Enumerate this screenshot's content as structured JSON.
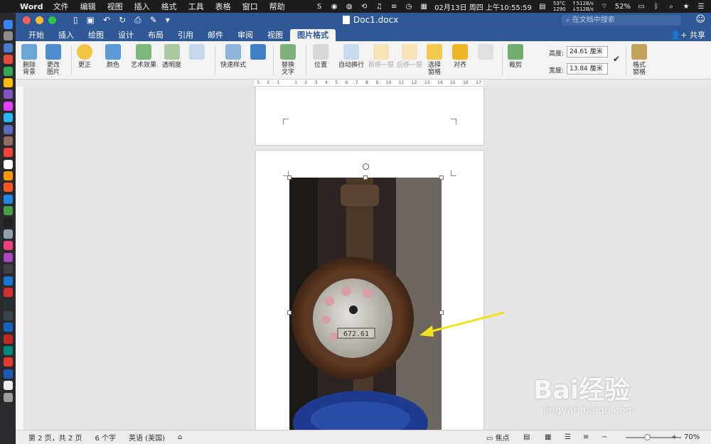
{
  "menubar": {
    "app_name": "Word",
    "menus": [
      "文件",
      "编辑",
      "视图",
      "插入",
      "格式",
      "工具",
      "表格",
      "窗口",
      "帮助"
    ],
    "datetime": "02月13日 周四 上午10:55:59",
    "battery": "52%",
    "temp_top": "53°C",
    "temp_bottom": "1290",
    "net_up": "↑512B/s",
    "net_down": "↓512B/s"
  },
  "titlebar": {
    "doc_title": "Doc1.docx",
    "search_placeholder": "在文档中搜索"
  },
  "tabs": [
    "开始",
    "插入",
    "绘图",
    "设计",
    "布局",
    "引用",
    "邮件",
    "审阅",
    "视图",
    "图片格式"
  ],
  "active_tab": "图片格式",
  "share_label": "共享",
  "ribbon": {
    "remove_bg": "删除\n背景",
    "change_pic": "更改\n图片",
    "corrections": "更正",
    "color": "颜色",
    "artistic": "艺术效果",
    "transparency": "透明度",
    "quick_styles": "快速样式",
    "alt_text": "替换\n文字",
    "position": "位置",
    "wrap_text": "自动换行",
    "bring_forward": "前移一层",
    "send_backward": "后移一层",
    "selection_pane": "选择\n窗格",
    "align": "对齐",
    "crop": "裁剪",
    "height_label": "高度:",
    "height_value": "24.61 厘米",
    "width_label": "宽度:",
    "width_value": "13.84 厘米",
    "format_pane": "格式\n窗格"
  },
  "ruler_ticks": [
    "3",
    "2",
    "1",
    "",
    "1",
    "2",
    "3",
    "4",
    "5",
    "6",
    "7",
    "8",
    "9",
    "10",
    "11",
    "12",
    "13",
    "14",
    "15",
    "16",
    "17"
  ],
  "statusbar": {
    "page_info": "第 2 页，共 2 页",
    "word_count": "6 个字",
    "language": "英语 (美国)",
    "focus": "焦点",
    "zoom": "70%"
  },
  "meter": {
    "reading": "672.61"
  },
  "watermark": {
    "brand": "Bai经验",
    "url": "jingyan.baidu.com"
  },
  "colors": {
    "title_blue": "#2f5897",
    "arrow_yellow": "#f2e21b"
  }
}
